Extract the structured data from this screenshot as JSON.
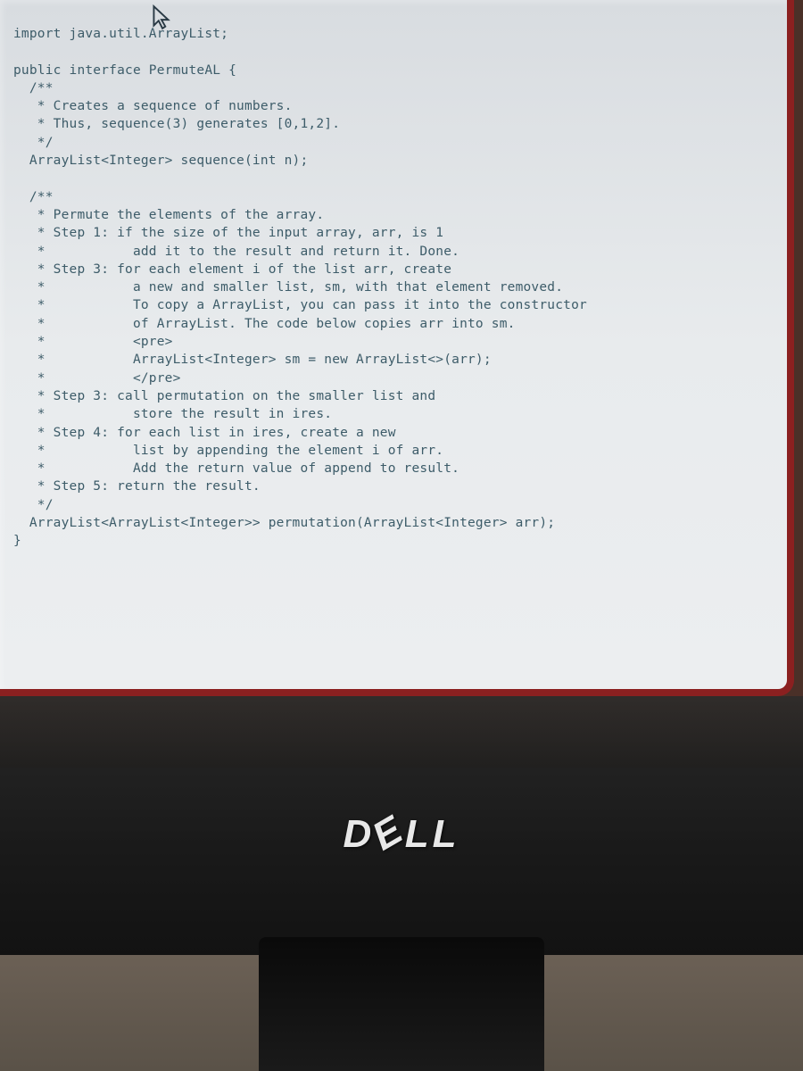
{
  "cursor_type": "arrow-pointer",
  "monitor_brand": "DELL",
  "code": {
    "lines": [
      "import java.util.ArrayList;",
      "",
      "public interface PermuteAL {",
      "  /**",
      "   * Creates a sequence of numbers.",
      "   * Thus, sequence(3) generates [0,1,2].",
      "   */",
      "  ArrayList<Integer> sequence(int n);",
      "",
      "  /**",
      "   * Permute the elements of the array.",
      "   * Step 1: if the size of the input array, arr, is 1",
      "   *           add it to the result and return it. Done.",
      "   * Step 3: for each element i of the list arr, create",
      "   *           a new and smaller list, sm, with that element removed.",
      "   *           To copy a ArrayList, you can pass it into the constructor",
      "   *           of ArrayList. The code below copies arr into sm.",
      "   *           <pre>",
      "   *           ArrayList<Integer> sm = new ArrayList<>(arr);",
      "   *           </pre>",
      "   * Step 3: call permutation on the smaller list and",
      "   *           store the result in ires.",
      "   * Step 4: for each list in ires, create a new",
      "   *           list by appending the element i of arr.",
      "   *           Add the return value of append to result.",
      "   * Step 5: return the result.",
      "   */",
      "  ArrayList<ArrayList<Integer>> permutation(ArrayList<Integer> arr);",
      "}"
    ]
  }
}
